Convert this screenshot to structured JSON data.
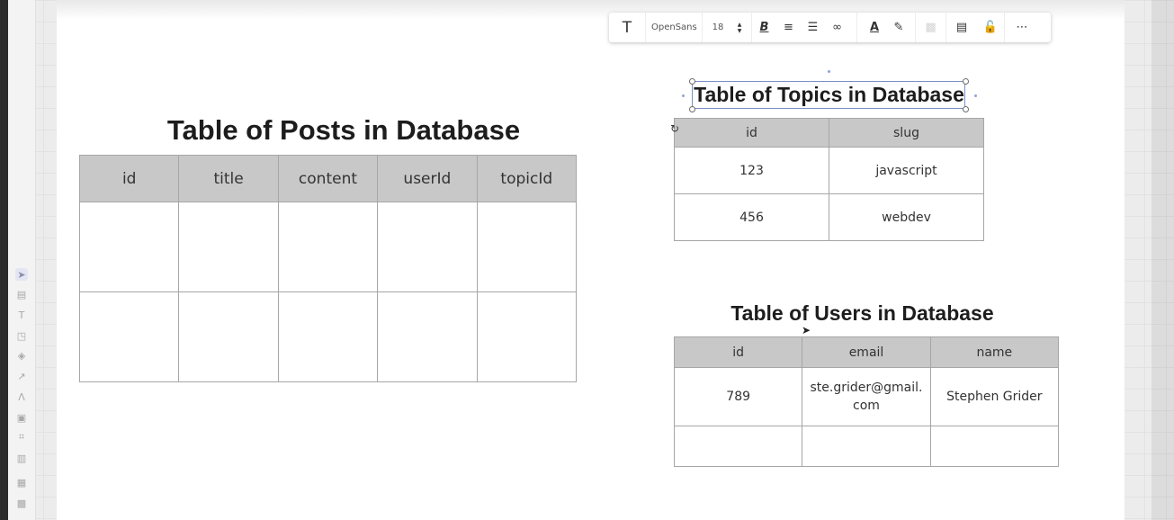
{
  "toolbar": {
    "text_tool_icon": "text-tool-icon",
    "font_name": "OpenSans",
    "font_size": "18",
    "items": [
      "bold-icon",
      "align-left-icon",
      "bullet-list-icon",
      "link-icon",
      "text-color-icon",
      "highlight-icon",
      "fill-icon",
      "comment-icon",
      "lock-icon",
      "more-icon"
    ]
  },
  "left_rail": [
    "select-tool-icon",
    "template-icon",
    "text-icon",
    "sticky-note-icon",
    "shapes-icon",
    "pen-icon",
    "connector-icon",
    "comment-icon",
    "frame-icon",
    "upload-icon",
    "table-icon",
    "add-icon"
  ],
  "posts": {
    "title": "Table of Posts in Database",
    "columns": [
      "id",
      "title",
      "content",
      "userId",
      "topicId"
    ]
  },
  "topics": {
    "title": "Table of Topics in Database",
    "columns": [
      "id",
      "slug"
    ],
    "rows": [
      [
        "123",
        "javascript"
      ],
      [
        "456",
        "webdev"
      ]
    ]
  },
  "users": {
    "title": "Table of Users in Database",
    "columns": [
      "id",
      "email",
      "name"
    ],
    "rows": [
      [
        "789",
        "ste.grider@gmail.com",
        "Stephen Grider"
      ]
    ]
  }
}
